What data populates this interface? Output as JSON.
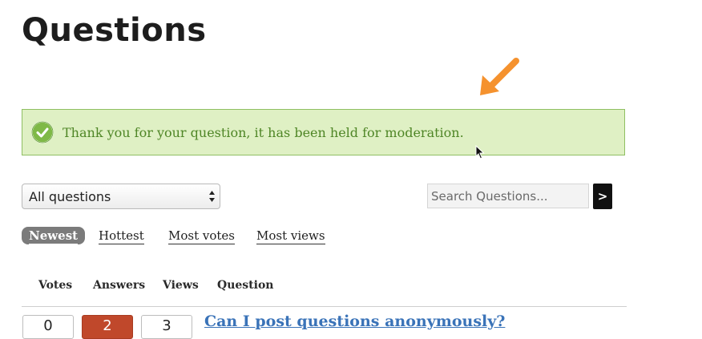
{
  "header": {
    "title": "Questions"
  },
  "notice": {
    "text": "Thank you for your question, it has been held for moderation.",
    "icon": "check-circle-icon",
    "background_color": "#dff0c4",
    "text_color": "#4f8626"
  },
  "annotation": {
    "icon": "arrow-icon",
    "color": "#f5922e"
  },
  "filter": {
    "selected": "All questions"
  },
  "search": {
    "placeholder": "Search Questions...",
    "button_label": ">"
  },
  "sort_tabs": [
    {
      "label": "Newest",
      "active": true
    },
    {
      "label": "Hottest",
      "active": false
    },
    {
      "label": "Most votes",
      "active": false
    },
    {
      "label": "Most views",
      "active": false
    }
  ],
  "table": {
    "columns": [
      "Votes",
      "Answers",
      "Views",
      "Question"
    ],
    "rows": [
      {
        "votes": "0",
        "answers": "2",
        "views": "3",
        "question": "Can I post questions anonymously?"
      }
    ]
  },
  "colors": {
    "accent_answers": "#c0482b",
    "link": "#3a73b8"
  }
}
